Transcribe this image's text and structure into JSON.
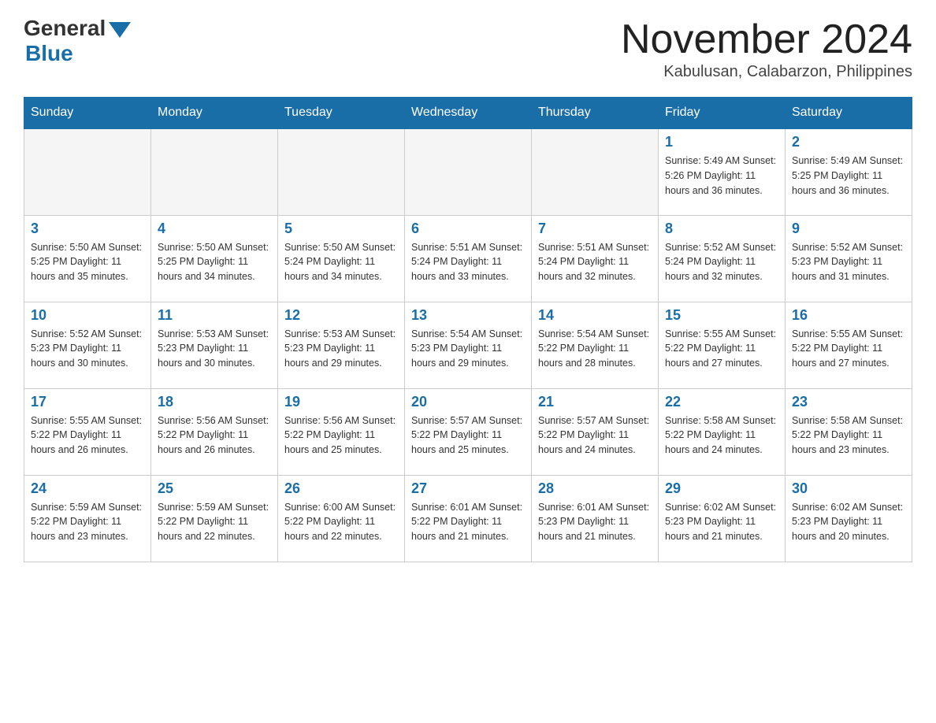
{
  "logo": {
    "general": "General",
    "blue": "Blue"
  },
  "header": {
    "month_year": "November 2024",
    "location": "Kabulusan, Calabarzon, Philippines"
  },
  "weekdays": [
    "Sunday",
    "Monday",
    "Tuesday",
    "Wednesday",
    "Thursday",
    "Friday",
    "Saturday"
  ],
  "weeks": [
    [
      {
        "day": "",
        "info": ""
      },
      {
        "day": "",
        "info": ""
      },
      {
        "day": "",
        "info": ""
      },
      {
        "day": "",
        "info": ""
      },
      {
        "day": "",
        "info": ""
      },
      {
        "day": "1",
        "info": "Sunrise: 5:49 AM\nSunset: 5:26 PM\nDaylight: 11 hours and 36 minutes."
      },
      {
        "day": "2",
        "info": "Sunrise: 5:49 AM\nSunset: 5:25 PM\nDaylight: 11 hours and 36 minutes."
      }
    ],
    [
      {
        "day": "3",
        "info": "Sunrise: 5:50 AM\nSunset: 5:25 PM\nDaylight: 11 hours and 35 minutes."
      },
      {
        "day": "4",
        "info": "Sunrise: 5:50 AM\nSunset: 5:25 PM\nDaylight: 11 hours and 34 minutes."
      },
      {
        "day": "5",
        "info": "Sunrise: 5:50 AM\nSunset: 5:24 PM\nDaylight: 11 hours and 34 minutes."
      },
      {
        "day": "6",
        "info": "Sunrise: 5:51 AM\nSunset: 5:24 PM\nDaylight: 11 hours and 33 minutes."
      },
      {
        "day": "7",
        "info": "Sunrise: 5:51 AM\nSunset: 5:24 PM\nDaylight: 11 hours and 32 minutes."
      },
      {
        "day": "8",
        "info": "Sunrise: 5:52 AM\nSunset: 5:24 PM\nDaylight: 11 hours and 32 minutes."
      },
      {
        "day": "9",
        "info": "Sunrise: 5:52 AM\nSunset: 5:23 PM\nDaylight: 11 hours and 31 minutes."
      }
    ],
    [
      {
        "day": "10",
        "info": "Sunrise: 5:52 AM\nSunset: 5:23 PM\nDaylight: 11 hours and 30 minutes."
      },
      {
        "day": "11",
        "info": "Sunrise: 5:53 AM\nSunset: 5:23 PM\nDaylight: 11 hours and 30 minutes."
      },
      {
        "day": "12",
        "info": "Sunrise: 5:53 AM\nSunset: 5:23 PM\nDaylight: 11 hours and 29 minutes."
      },
      {
        "day": "13",
        "info": "Sunrise: 5:54 AM\nSunset: 5:23 PM\nDaylight: 11 hours and 29 minutes."
      },
      {
        "day": "14",
        "info": "Sunrise: 5:54 AM\nSunset: 5:22 PM\nDaylight: 11 hours and 28 minutes."
      },
      {
        "day": "15",
        "info": "Sunrise: 5:55 AM\nSunset: 5:22 PM\nDaylight: 11 hours and 27 minutes."
      },
      {
        "day": "16",
        "info": "Sunrise: 5:55 AM\nSunset: 5:22 PM\nDaylight: 11 hours and 27 minutes."
      }
    ],
    [
      {
        "day": "17",
        "info": "Sunrise: 5:55 AM\nSunset: 5:22 PM\nDaylight: 11 hours and 26 minutes."
      },
      {
        "day": "18",
        "info": "Sunrise: 5:56 AM\nSunset: 5:22 PM\nDaylight: 11 hours and 26 minutes."
      },
      {
        "day": "19",
        "info": "Sunrise: 5:56 AM\nSunset: 5:22 PM\nDaylight: 11 hours and 25 minutes."
      },
      {
        "day": "20",
        "info": "Sunrise: 5:57 AM\nSunset: 5:22 PM\nDaylight: 11 hours and 25 minutes."
      },
      {
        "day": "21",
        "info": "Sunrise: 5:57 AM\nSunset: 5:22 PM\nDaylight: 11 hours and 24 minutes."
      },
      {
        "day": "22",
        "info": "Sunrise: 5:58 AM\nSunset: 5:22 PM\nDaylight: 11 hours and 24 minutes."
      },
      {
        "day": "23",
        "info": "Sunrise: 5:58 AM\nSunset: 5:22 PM\nDaylight: 11 hours and 23 minutes."
      }
    ],
    [
      {
        "day": "24",
        "info": "Sunrise: 5:59 AM\nSunset: 5:22 PM\nDaylight: 11 hours and 23 minutes."
      },
      {
        "day": "25",
        "info": "Sunrise: 5:59 AM\nSunset: 5:22 PM\nDaylight: 11 hours and 22 minutes."
      },
      {
        "day": "26",
        "info": "Sunrise: 6:00 AM\nSunset: 5:22 PM\nDaylight: 11 hours and 22 minutes."
      },
      {
        "day": "27",
        "info": "Sunrise: 6:01 AM\nSunset: 5:22 PM\nDaylight: 11 hours and 21 minutes."
      },
      {
        "day": "28",
        "info": "Sunrise: 6:01 AM\nSunset: 5:23 PM\nDaylight: 11 hours and 21 minutes."
      },
      {
        "day": "29",
        "info": "Sunrise: 6:02 AM\nSunset: 5:23 PM\nDaylight: 11 hours and 21 minutes."
      },
      {
        "day": "30",
        "info": "Sunrise: 6:02 AM\nSunset: 5:23 PM\nDaylight: 11 hours and 20 minutes."
      }
    ]
  ]
}
